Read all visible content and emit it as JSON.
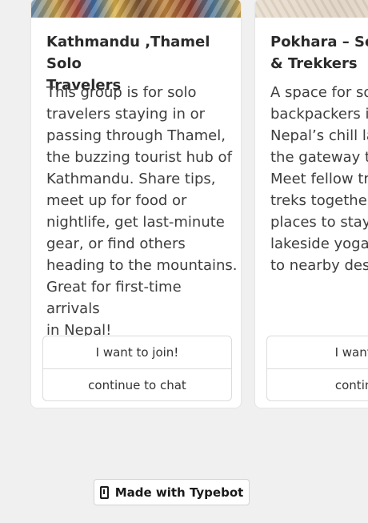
{
  "cards": [
    {
      "title": "Kathmandu ,Thamel Solo\nTravelers",
      "description": "This group is for solo\ntravelers staying in or\npassing through Thamel,\nthe buzzing tourist hub of\nKathmandu. Share tips,\nmeet up for food or\nnightlife, get last-minute\ngear, or find others\nheading to the mountains.\nGreat for first-time arrivals\nin Nepal!",
      "join_label": "I want to join!",
      "chat_label": "continue to chat"
    },
    {
      "title": "Pokhara – Solo\n& Trekkers",
      "description": "A space for sol\nbackpackers in\nNepal’s chill lak\nthe gateway to\nMeet fellow tra\ntreks together,\nplaces to stay o\nlakeside yoga,\nto nearby desti",
      "join_label": "I want to",
      "chat_label": "continue"
    }
  ],
  "footer": {
    "badge_label": "Made with Typebot",
    "badge_icon": "typebot-logo-icon"
  }
}
